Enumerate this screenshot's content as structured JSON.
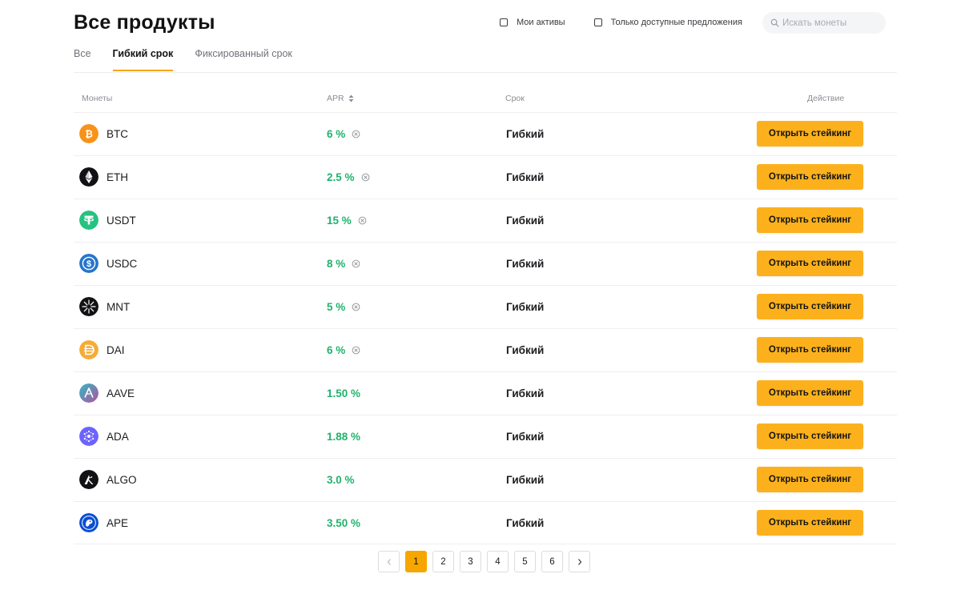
{
  "page": {
    "title": "Все продукты"
  },
  "filters": {
    "my_assets": "Мои активы",
    "available_only": "Только доступные предложения"
  },
  "search": {
    "placeholder": "Искать монеты"
  },
  "tabs": [
    {
      "label": "Все",
      "active": false
    },
    {
      "label": "Гибкий срок",
      "active": true
    },
    {
      "label": "Фиксированный срок",
      "active": false
    }
  ],
  "table": {
    "headers": {
      "coin": "Монеты",
      "apr": "APR",
      "term": "Срок",
      "action": "Действие"
    },
    "rows": [
      {
        "coin": "BTC",
        "apr": "6 %",
        "apr_info": true,
        "term": "Гибкий",
        "action": "Открыть стейкинг",
        "icon": "btc-icon"
      },
      {
        "coin": "ETH",
        "apr": "2.5 %",
        "apr_info": true,
        "term": "Гибкий",
        "action": "Открыть стейкинг",
        "icon": "eth-icon"
      },
      {
        "coin": "USDT",
        "apr": "15 %",
        "apr_info": true,
        "term": "Гибкий",
        "action": "Открыть стейкинг",
        "icon": "usdt-icon"
      },
      {
        "coin": "USDC",
        "apr": "8 %",
        "apr_info": true,
        "term": "Гибкий",
        "action": "Открыть стейкинг",
        "icon": "usdc-icon"
      },
      {
        "coin": "MNT",
        "apr": "5 %",
        "apr_info": true,
        "term": "Гибкий",
        "action": "Открыть стейкинг",
        "icon": "mnt-icon"
      },
      {
        "coin": "DAI",
        "apr": "6 %",
        "apr_info": true,
        "term": "Гибкий",
        "action": "Открыть стейкинг",
        "icon": "dai-icon"
      },
      {
        "coin": "AAVE",
        "apr": "1.50 %",
        "apr_info": false,
        "term": "Гибкий",
        "action": "Открыть стейкинг",
        "icon": "aave-icon"
      },
      {
        "coin": "ADA",
        "apr": "1.88 %",
        "apr_info": false,
        "term": "Гибкий",
        "action": "Открыть стейкинг",
        "icon": "ada-icon"
      },
      {
        "coin": "ALGO",
        "apr": "3.0 %",
        "apr_info": false,
        "term": "Гибкий",
        "action": "Открыть стейкинг",
        "icon": "algo-icon"
      },
      {
        "coin": "APE",
        "apr": "3.50 %",
        "apr_info": false,
        "term": "Гибкий",
        "action": "Открыть стейкинг",
        "icon": "ape-icon"
      }
    ]
  },
  "pagination": {
    "pages": [
      "1",
      "2",
      "3",
      "4",
      "5",
      "6"
    ],
    "current": "1"
  },
  "colors": {
    "accent": "#f7a600",
    "button": "#fcb11c",
    "apr_green": "#20b26c"
  }
}
